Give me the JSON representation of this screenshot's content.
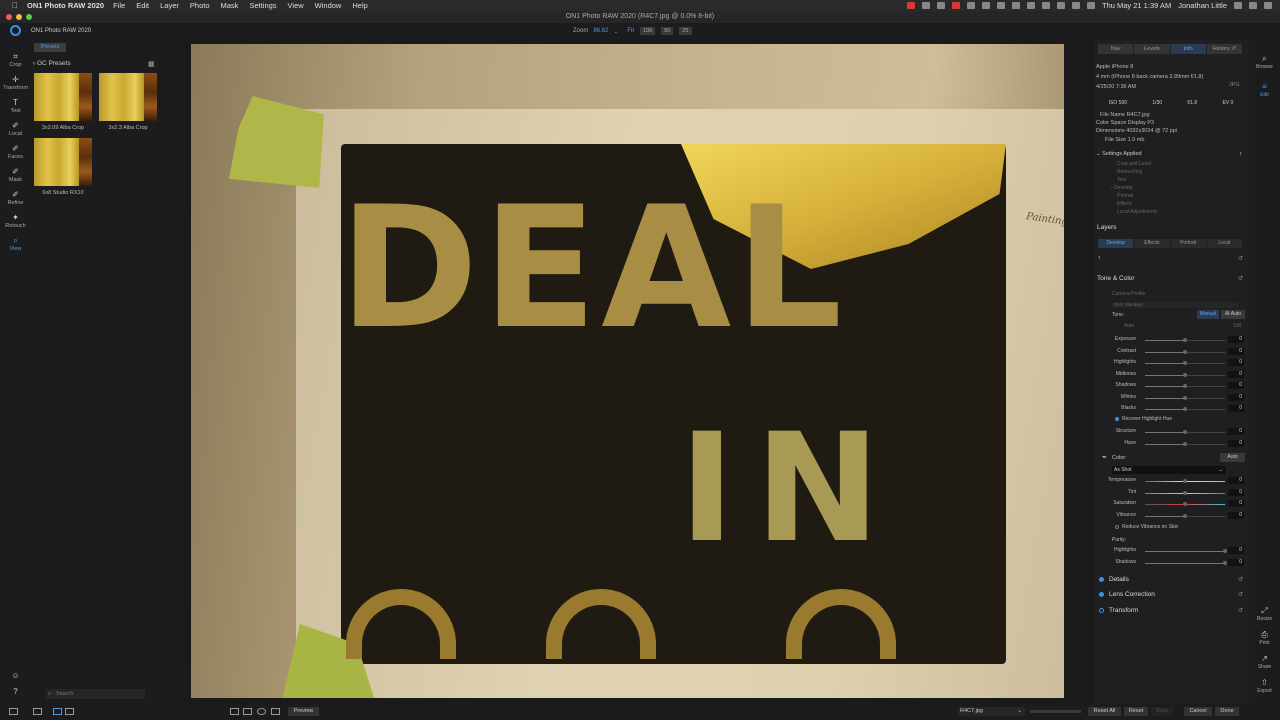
{
  "menubar": {
    "app_name": "ON1 Photo RAW 2020",
    "items": [
      "File",
      "Edit",
      "Layer",
      "Photo",
      "Mask",
      "Settings",
      "View",
      "Window",
      "Help"
    ],
    "clock": "Thu May 21  1:39 AM",
    "user": "Jonathan Little"
  },
  "window": {
    "title": "ON1 Photo RAW 2020 (R4C7.jpg @ 0.0% 8-bit)"
  },
  "toolbar": {
    "product": "ON1 Photo RAW 2020",
    "zoom_label": "Zoom",
    "zoom_value": "86.62",
    "fit_label": "Fit",
    "zoom_presets": [
      "100",
      "50",
      "25"
    ]
  },
  "left_tools": [
    "Crop",
    "Transform",
    "Text",
    "Local",
    "Faces",
    "Mask",
    "Refine",
    "Retouch",
    "View"
  ],
  "presets": {
    "tab": "Presets",
    "category": "GC Presets",
    "items": [
      {
        "label": "3x2.09 Alba Crop"
      },
      {
        "label": "3x2.3 Alba Crop"
      },
      {
        "label": "6x8 Studio RX10"
      }
    ],
    "search_placeholder": "Search"
  },
  "photo": {
    "line1": "DEAL",
    "line2": "IN",
    "signature": "Painting"
  },
  "right_panel": {
    "tabs": [
      "Nav",
      "Levels",
      "Info",
      "History"
    ],
    "active_tab": "Info",
    "camera": "Apple iPhone 8",
    "lens": "4 mm (iPhone 8 back camera 3.99mm f/1.8)",
    "date": "4/25/20 7:36 AM",
    "format": "JPG",
    "exif": [
      "ISO 500",
      "1/30",
      "f/1.8",
      "EV 0"
    ],
    "file_name": "File Name R4C7.jpg",
    "color_space": "Color Space Display P3",
    "dimensions": "Dimensions 4032x3024 @ 72 ppi",
    "file_size": "File Size 1.0 mb",
    "settings_applied": "Settings Applied",
    "settings_items": [
      "Crop and Level",
      "Retouching",
      "Text",
      "Develop",
      "Portrait",
      "Effects",
      "Local Adjustments"
    ],
    "layers_title": "Layers",
    "layer_tabs": [
      "Develop",
      "Effects",
      "Portrait",
      "Local"
    ],
    "active_layer_tab": "Develop",
    "tone_color": {
      "title": "Tone & Color",
      "camera_profile_label": "Camera Profile",
      "camera_profile_value": "ON1 Standard",
      "tone_label": "Tone:",
      "manual_label": "Manual",
      "ai_auto_label": "AI Auto",
      "auto_label": "Auto",
      "auto_value": "100",
      "sliders": [
        {
          "label": "Exposure",
          "value": "0",
          "pos": 0.5
        },
        {
          "label": "Contrast",
          "value": "0",
          "pos": 0.5
        },
        {
          "label": "Highlights",
          "value": "0",
          "pos": 0.5
        },
        {
          "label": "Midtones",
          "value": "0",
          "pos": 0.5
        },
        {
          "label": "Shadows",
          "value": "0",
          "pos": 0.5
        },
        {
          "label": "Whites",
          "value": "0",
          "pos": 0.5
        },
        {
          "label": "Blacks",
          "value": "0",
          "pos": 0.5
        }
      ],
      "recover_label": "Recover Highlight Hue",
      "sliders2": [
        {
          "label": "Structure",
          "value": "0",
          "pos": 0.5
        },
        {
          "label": "Haze",
          "value": "0",
          "pos": 0.5
        }
      ],
      "color_label": "Color:",
      "color_auto": "Auto",
      "wb_value": "As Shot",
      "color_sliders": [
        {
          "label": "Temperature",
          "value": "0",
          "pos": 0.5
        },
        {
          "label": "Tint",
          "value": "0",
          "pos": 0.5
        },
        {
          "label": "Saturation",
          "value": "0",
          "pos": 0.5
        },
        {
          "label": "Vibrance",
          "value": "0",
          "pos": 0.5
        }
      ],
      "reduce_vibrance_label": "Reduce Vibrance on Skin",
      "purity_label": "Purity:",
      "purity_sliders": [
        {
          "label": "Highlights",
          "value": "0",
          "pos": 1.0
        },
        {
          "label": "Shadows",
          "value": "0",
          "pos": 1.0
        }
      ]
    },
    "collapsed_sections": [
      "Details",
      "Lens Correction",
      "Transform"
    ]
  },
  "right_rail": {
    "browse": "Browse",
    "edit": "Edit",
    "resize": "Resize",
    "print": "Print",
    "share": "Share",
    "export": "Export"
  },
  "bottombar": {
    "preview": "Preview",
    "file": "R4C7.jpg",
    "reset_all": "Reset All",
    "reset": "Reset",
    "sync": "Sync",
    "cancel": "Cancel",
    "done": "Done"
  }
}
